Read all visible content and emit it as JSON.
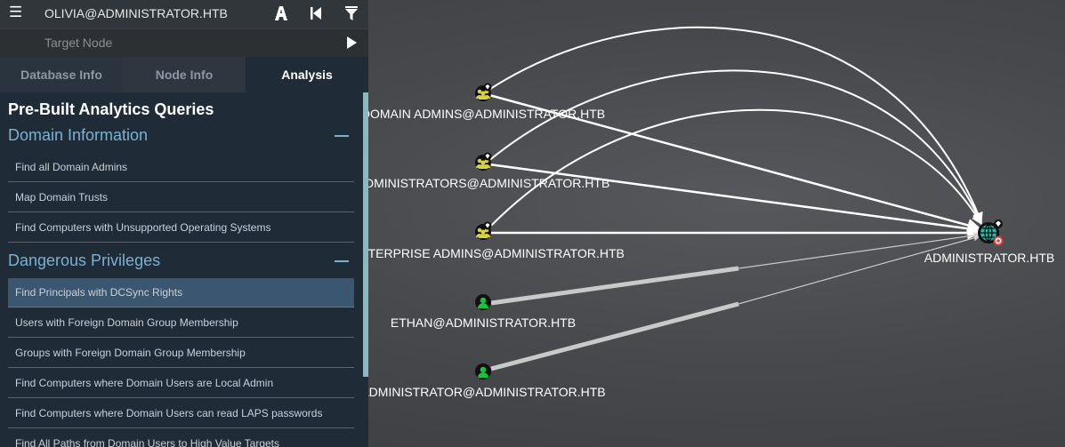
{
  "search": {
    "start_value": "OLIVIA@ADMINISTRATOR.HTB",
    "target_placeholder": "Target Node"
  },
  "toolbar_icons": [
    "path-finding-icon",
    "back-icon",
    "filter-icon",
    "play-icon"
  ],
  "tabs": [
    {
      "label": "Database Info",
      "active": false
    },
    {
      "label": "Node Info",
      "active": false
    },
    {
      "label": "Analysis",
      "active": true
    }
  ],
  "analysis": {
    "title": "Pre-Built Analytics Queries",
    "sections": [
      {
        "name": "Domain Information",
        "items": [
          "Find all Domain Admins",
          "Map Domain Trusts",
          "Find Computers with Unsupported Operating Systems"
        ]
      },
      {
        "name": "Dangerous Privileges",
        "items": [
          "Find Principals with DCSync Rights",
          "Users with Foreign Domain Group Membership",
          "Groups with Foreign Domain Group Membership",
          "Find Computers where Domain Users are Local Admin",
          "Find Computers where Domain Users can read LAPS passwords",
          "Find All Paths from Domain Users to High Value Targets"
        ],
        "selected_index": 0
      }
    ]
  },
  "graph": {
    "nodes": [
      {
        "label": "DOMAIN ADMINS@ADMINISTRATOR.HTB",
        "type": "group"
      },
      {
        "label": "ADMINISTRATORS@ADMINISTRATOR.HTB",
        "type": "group"
      },
      {
        "label": "ENTERPRISE ADMINS@ADMINISTRATOR.HTB",
        "type": "group"
      },
      {
        "label": "ETHAN@ADMINISTRATOR.HTB",
        "type": "user"
      },
      {
        "label": "ADMINISTRATOR@ADMINISTRATOR.HTB",
        "type": "user"
      },
      {
        "label": "ADMINISTRATOR.HTB",
        "type": "domain"
      }
    ],
    "colors": {
      "group": "#d8d33a",
      "user": "#18c23c",
      "domain": "#2ab7a9",
      "edge": "#ffffff",
      "edge_gray": "#bdbdbd"
    }
  }
}
